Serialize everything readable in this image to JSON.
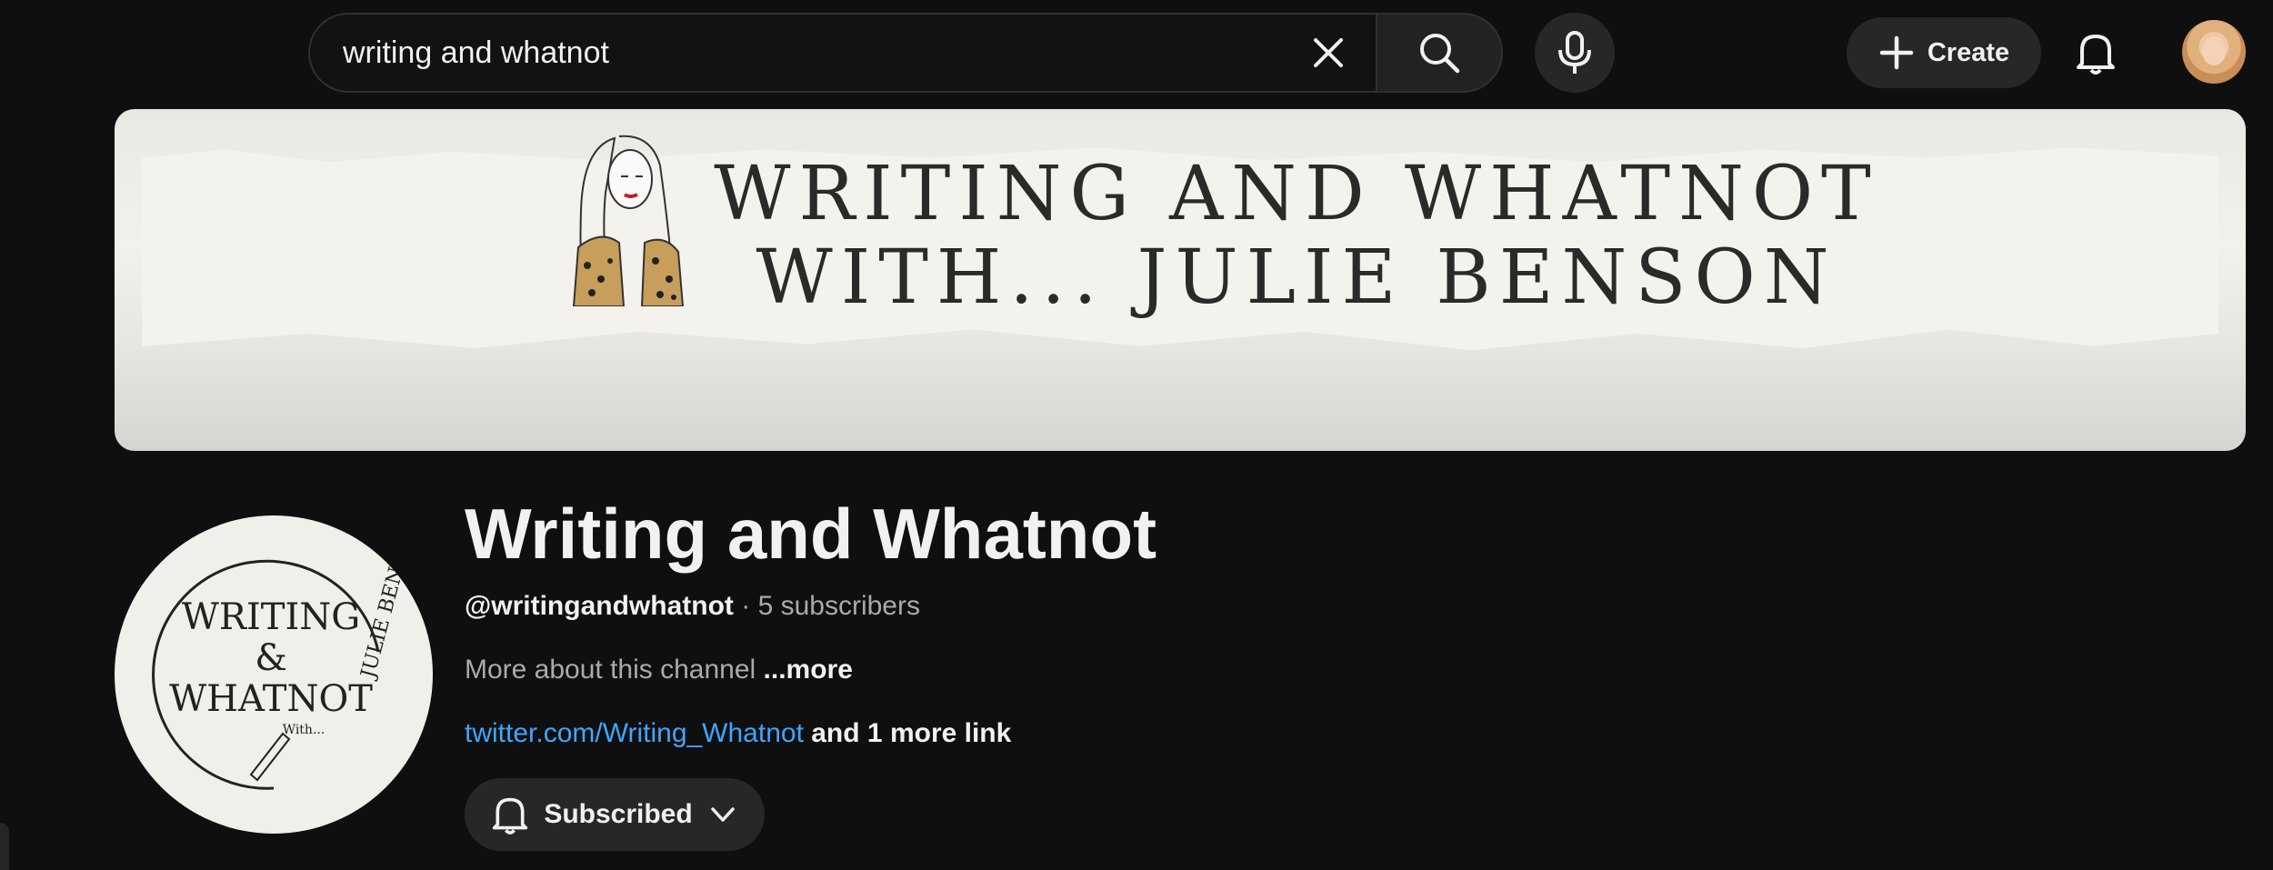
{
  "topbar": {
    "search_value": "writing and whatnot",
    "create_label": "Create"
  },
  "banner": {
    "title_line1": "WRITING AND WHATNOT",
    "title_line2": "WITH... JULIE BENSON"
  },
  "channel": {
    "name": "Writing and Whatnot",
    "handle": "@writingandwhatnot",
    "separator": "·",
    "subscribers": "5 subscribers",
    "about": "More about this channel",
    "about_more": "...more",
    "link": "twitter.com/Writing_Whatnot",
    "more_links": "and 1 more link",
    "subscribed_label": "Subscribed",
    "logo": {
      "line1": "WRITING",
      "line2": "&",
      "line3": "WHATNOT",
      "with": "With...",
      "arc": "JULIE BENSON"
    }
  },
  "colors": {
    "background": "#0f0f0f",
    "link": "#3ea6ff",
    "button_bg": "#272727"
  }
}
